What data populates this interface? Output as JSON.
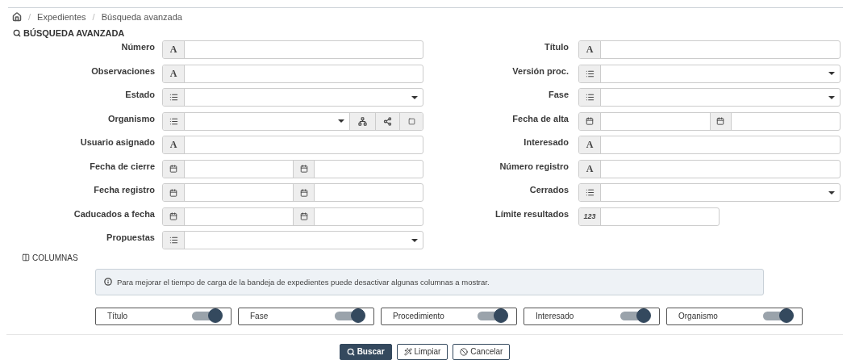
{
  "breadcrumb": [
    {
      "separator": "/",
      "label": "Expedientes"
    },
    {
      "separator": "/",
      "label": "Búsqueda avanzada"
    }
  ],
  "search_title": "BÚSQUEDA AVANZADA",
  "left_fields": [
    {
      "label": "Número",
      "kind": "text",
      "addon": "A"
    },
    {
      "label": "Observaciones",
      "kind": "text",
      "addon": "A"
    },
    {
      "label": "Estado",
      "kind": "select"
    },
    {
      "label": "Organismo",
      "kind": "org"
    },
    {
      "label": "Usuario asignado",
      "kind": "text",
      "addon": "A"
    },
    {
      "label": "Fecha de cierre",
      "kind": "daterange"
    },
    {
      "label": "Fecha registro",
      "kind": "daterange"
    },
    {
      "label": "Caducados a fecha",
      "kind": "daterange"
    },
    {
      "label": "Propuestas",
      "kind": "select"
    }
  ],
  "right_fields": [
    {
      "label": "Título",
      "kind": "text",
      "addon": "A"
    },
    {
      "label": "Versión proc.",
      "kind": "select"
    },
    {
      "label": "Fase",
      "kind": "select"
    },
    {
      "label": "Fecha de alta",
      "kind": "daterange"
    },
    {
      "label": "Interesado",
      "kind": "text",
      "addon": "A"
    },
    {
      "label": "Número registro",
      "kind": "text",
      "addon": "A"
    },
    {
      "label": "Cerrados",
      "kind": "select"
    },
    {
      "label": "Límite resultados",
      "kind": "number",
      "addon": "123"
    }
  ],
  "columns_title": "COLUMNAS",
  "info": "Para mejorar el tiempo de carga de la bandeja de expedientes puede desactivar algunas columnas a mostrar.",
  "column_toggles": [
    {
      "label": "Título",
      "on": true
    },
    {
      "label": "Fase",
      "on": true
    },
    {
      "label": "Procedimiento",
      "on": true
    },
    {
      "label": "Interesado",
      "on": true
    },
    {
      "label": "Organismo",
      "on": true
    }
  ],
  "buttons": [
    {
      "label": "Buscar",
      "kind": "primary"
    },
    {
      "label": "Limpiar",
      "kind": "clear"
    },
    {
      "label": "Cancelar",
      "kind": "cancel"
    }
  ]
}
